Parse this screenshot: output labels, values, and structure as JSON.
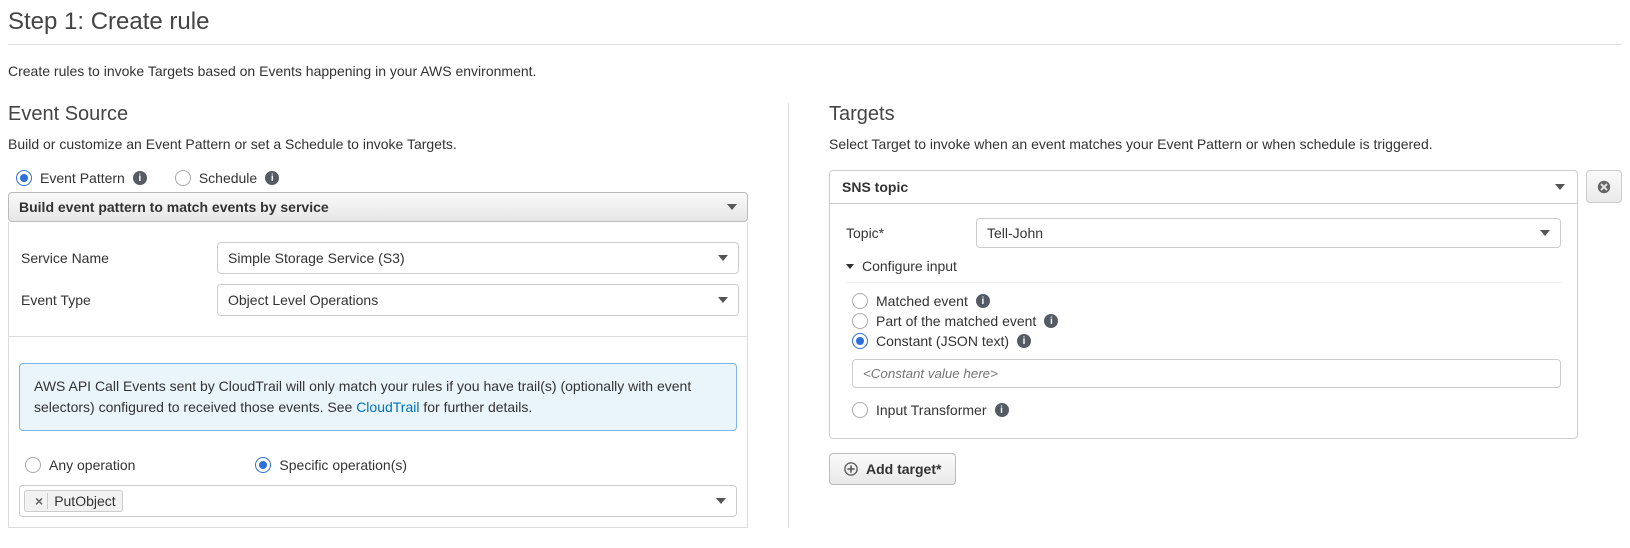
{
  "header": {
    "title": "Step 1: Create rule",
    "intro": "Create rules to invoke Targets based on Events happening in your AWS environment."
  },
  "source": {
    "title": "Event Source",
    "sub": "Build or customize an Event Pattern or set a Schedule to invoke Targets.",
    "radio_pattern": "Event Pattern",
    "radio_schedule": "Schedule",
    "build_mode": "Build event pattern to match events by service",
    "service_name_label": "Service Name",
    "service_name_value": "Simple Storage Service (S3)",
    "event_type_label": "Event Type",
    "event_type_value": "Object Level Operations",
    "info_text_a": "AWS API Call Events sent by CloudTrail will only match your rules if you have trail(s) (optionally with event selectors) configured to received those events. See ",
    "info_link": "CloudTrail",
    "info_text_b": " for further details.",
    "op_any": "Any operation",
    "op_specific": "Specific operation(s)",
    "operation_tag": "PutObject"
  },
  "targets": {
    "title": "Targets",
    "sub": "Select Target to invoke when an event matches your Event Pattern or when schedule is triggered.",
    "type_value": "SNS topic",
    "topic_label": "Topic*",
    "topic_value": "Tell-John",
    "configure_input": "Configure input",
    "input_matched": "Matched event",
    "input_part": "Part of the matched event",
    "input_constant": "Constant (JSON text)",
    "constant_placeholder": "<Constant value here>",
    "input_transformer": "Input Transformer",
    "add_target": "Add target*"
  }
}
